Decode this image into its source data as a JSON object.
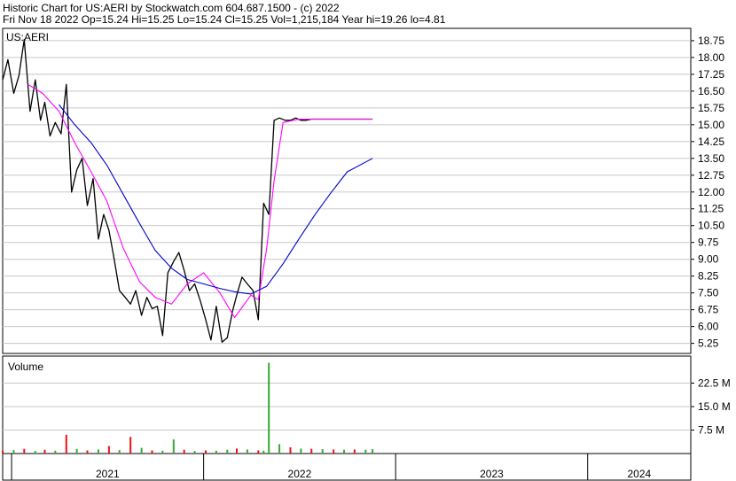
{
  "header": {
    "line1": "Historic Chart for US:AERI by Stockwatch.com 604.687.1500 - (c) 2022",
    "line2": "Fri Nov 18 2022  Op=15.24  Hi=15.25  Lo=15.24  Cl=15.25  Vol=1,215,184  Year hi=19.26  lo=4.81"
  },
  "colors": {
    "price": "#000000",
    "ma_short": "#ff00ff",
    "ma_long": "#0000cc",
    "vol_up": "#33aa33",
    "vol_down": "#ee1111",
    "grid": "#c8c8c8"
  },
  "chart_data": {
    "type": "line",
    "symbol": "US:AERI",
    "price_axis": {
      "ticks": [
        "18.75",
        "18.00",
        "17.25",
        "16.50",
        "15.75",
        "15.00",
        "14.25",
        "13.50",
        "12.75",
        "12.00",
        "11.25",
        "10.50",
        "9.75",
        "9.00",
        "8.25",
        "7.50",
        "6.75",
        "6.00",
        "5.25"
      ],
      "ylim": [
        4.8,
        19.3
      ]
    },
    "volume_panel": {
      "label": "Volume",
      "ticks": [
        "22.5 M",
        "15.0 M",
        "7.5 M"
      ],
      "tick_values": [
        22.5,
        15.0,
        7.5
      ],
      "ylim": [
        0,
        30
      ]
    },
    "x_axis": {
      "labels": [
        "2021",
        "2022",
        "2023",
        "2024"
      ],
      "range": [
        "2020-12-15",
        "2024-07-15"
      ],
      "year_starts": [
        "2021-01-01",
        "2022-01-01",
        "2023-01-01",
        "2024-01-01"
      ]
    },
    "series": [
      {
        "key": "price",
        "x": [
          "2020-12-15",
          "2020-12-25",
          "2021-01-05",
          "2021-01-15",
          "2021-01-25",
          "2021-02-05",
          "2021-02-15",
          "2021-02-25",
          "2021-03-05",
          "2021-03-15",
          "2021-03-25",
          "2021-04-05",
          "2021-04-15",
          "2021-04-25",
          "2021-05-05",
          "2021-05-15",
          "2021-05-25",
          "2021-06-05",
          "2021-06-15",
          "2021-06-25",
          "2021-07-05",
          "2021-07-15",
          "2021-07-25",
          "2021-08-05",
          "2021-08-15",
          "2021-08-25",
          "2021-09-05",
          "2021-09-15",
          "2021-09-25",
          "2021-10-05",
          "2021-10-15",
          "2021-10-25",
          "2021-11-05",
          "2021-11-15",
          "2021-11-25",
          "2021-12-05",
          "2021-12-15",
          "2021-12-25",
          "2022-01-05",
          "2022-01-15",
          "2022-01-25",
          "2022-02-05",
          "2022-02-15",
          "2022-02-25",
          "2022-03-05",
          "2022-03-15",
          "2022-03-25",
          "2022-04-05",
          "2022-04-15",
          "2022-04-25",
          "2022-05-05",
          "2022-05-15",
          "2022-05-25",
          "2022-06-05",
          "2022-06-15",
          "2022-06-25",
          "2022-07-05",
          "2022-07-15",
          "2022-07-25",
          "2022-08-05",
          "2022-08-15",
          "2022-08-25",
          "2022-09-05",
          "2022-09-15",
          "2022-09-25",
          "2022-10-05",
          "2022-10-15",
          "2022-10-25",
          "2022-11-05",
          "2022-11-18"
        ],
        "values": [
          17.0,
          17.9,
          16.4,
          17.2,
          18.8,
          15.6,
          17.0,
          15.2,
          16.0,
          14.5,
          15.1,
          14.6,
          16.8,
          12.0,
          13.0,
          13.5,
          11.4,
          12.6,
          9.9,
          11.0,
          10.3,
          9.0,
          7.6,
          7.3,
          7.0,
          7.6,
          6.5,
          7.3,
          6.8,
          6.9,
          5.6,
          8.4,
          8.9,
          9.3,
          8.5,
          7.6,
          7.9,
          7.2,
          6.3,
          5.4,
          6.9,
          5.3,
          5.5,
          6.7,
          7.4,
          8.2,
          7.9,
          7.6,
          6.3,
          11.5,
          11.0,
          15.2,
          15.3,
          15.2,
          15.2,
          15.3,
          15.2,
          15.2,
          15.25,
          15.25,
          15.25,
          15.25,
          15.25,
          15.25,
          15.25,
          15.25,
          15.25,
          15.25,
          15.25,
          15.25
        ]
      },
      {
        "key": "ma_short",
        "x": [
          "2021-02-01",
          "2021-03-01",
          "2021-04-01",
          "2021-05-01",
          "2021-06-01",
          "2021-07-01",
          "2021-08-01",
          "2021-09-01",
          "2021-10-01",
          "2021-11-01",
          "2021-12-01",
          "2022-01-01",
          "2022-02-01",
          "2022-03-01",
          "2022-04-01",
          "2022-04-15",
          "2022-05-01",
          "2022-05-15",
          "2022-06-01",
          "2022-07-01",
          "2022-08-01",
          "2022-09-01",
          "2022-10-01",
          "2022-11-18"
        ],
        "values": [
          16.8,
          16.4,
          15.6,
          14.2,
          12.9,
          11.6,
          9.5,
          8.0,
          7.3,
          7.0,
          7.9,
          8.4,
          7.5,
          6.4,
          7.4,
          7.2,
          9.5,
          12.5,
          15.1,
          15.25,
          15.25,
          15.25,
          15.25,
          15.25
        ]
      },
      {
        "key": "ma_long",
        "x": [
          "2021-04-01",
          "2021-05-01",
          "2021-06-01",
          "2021-07-01",
          "2021-08-01",
          "2021-09-01",
          "2021-10-01",
          "2021-11-01",
          "2021-12-01",
          "2022-01-01",
          "2022-02-01",
          "2022-03-01",
          "2022-04-01",
          "2022-05-01",
          "2022-06-01",
          "2022-07-01",
          "2022-08-01",
          "2022-09-01",
          "2022-10-01",
          "2022-11-18"
        ],
        "values": [
          15.9,
          15.0,
          14.2,
          13.2,
          11.9,
          10.6,
          9.4,
          8.6,
          8.1,
          7.9,
          7.7,
          7.55,
          7.45,
          7.8,
          8.8,
          9.9,
          11.0,
          12.0,
          12.9,
          13.5
        ]
      }
    ],
    "volume": {
      "x": [
        "2020-12-15",
        "2021-01-05",
        "2021-01-25",
        "2021-02-15",
        "2021-03-05",
        "2021-03-25",
        "2021-04-15",
        "2021-05-05",
        "2021-05-25",
        "2021-06-15",
        "2021-07-05",
        "2021-07-25",
        "2021-08-15",
        "2021-09-05",
        "2021-09-25",
        "2021-10-15",
        "2021-11-05",
        "2021-11-25",
        "2021-12-15",
        "2022-01-05",
        "2022-01-25",
        "2022-02-15",
        "2022-03-05",
        "2022-03-25",
        "2022-04-15",
        "2022-04-25",
        "2022-05-05",
        "2022-05-25",
        "2022-06-15",
        "2022-07-05",
        "2022-07-25",
        "2022-08-15",
        "2022-09-05",
        "2022-09-25",
        "2022-10-15",
        "2022-11-05",
        "2022-11-18"
      ],
      "values": [
        0.9,
        1.1,
        1.5,
        0.8,
        1.2,
        0.9,
        6.0,
        1.5,
        1.0,
        1.3,
        2.4,
        1.1,
        5.3,
        1.8,
        1.0,
        0.9,
        4.5,
        1.2,
        0.8,
        1.0,
        0.9,
        1.2,
        1.6,
        1.3,
        1.0,
        0.9,
        29.0,
        3.0,
        2.0,
        1.6,
        1.5,
        1.4,
        1.3,
        1.2,
        1.3,
        1.2,
        1.4
      ],
      "up": [
        false,
        true,
        false,
        true,
        false,
        true,
        false,
        true,
        false,
        true,
        false,
        true,
        false,
        true,
        false,
        true,
        true,
        false,
        true,
        false,
        true,
        true,
        false,
        true,
        false,
        true,
        true,
        true,
        false,
        true,
        false,
        true,
        false,
        true,
        false,
        true,
        true
      ]
    }
  }
}
